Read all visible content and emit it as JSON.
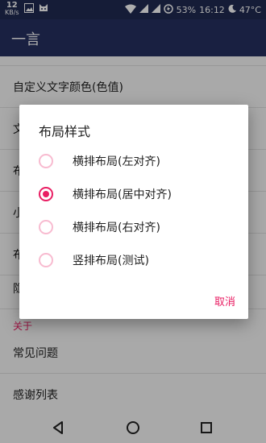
{
  "status_bar": {
    "net_speed": "12",
    "net_unit": "KB/s",
    "battery": "53%",
    "time": "16:12",
    "temperature": "47°C"
  },
  "app_bar": {
    "title": "一言"
  },
  "settings": {
    "rows": [
      {
        "label": ""
      },
      {
        "label": "自定义文字颜色(色值)"
      },
      {
        "label": "文"
      },
      {
        "label": "布"
      },
      {
        "label": "小"
      },
      {
        "label": "布"
      },
      {
        "label": "隐"
      }
    ],
    "section_about": "关于",
    "about_rows": [
      {
        "label": "常见问题"
      },
      {
        "label": "感谢列表"
      }
    ]
  },
  "dialog": {
    "title": "布局样式",
    "options": [
      {
        "label": "横排布局(左对齐)",
        "checked": false
      },
      {
        "label": "横排布局(居中对齐)",
        "checked": true
      },
      {
        "label": "横排布局(右对齐)",
        "checked": false
      },
      {
        "label": "竖排布局(测试)",
        "checked": false
      }
    ],
    "cancel_label": "取消"
  },
  "colors": {
    "accent": "#e91e63",
    "app_bar": "#253061",
    "status_bar": "#1f2a52"
  }
}
